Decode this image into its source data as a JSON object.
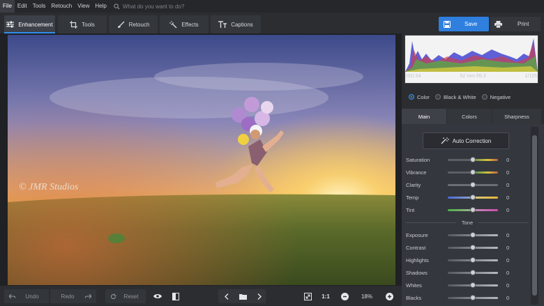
{
  "menu": {
    "items": [
      "File",
      "Edit",
      "Tools",
      "Retouch",
      "View",
      "Help"
    ],
    "search_placeholder": "What do you want to do?"
  },
  "tabs": [
    {
      "label": "Enhancement",
      "icon": "sliders-icon"
    },
    {
      "label": "Tools",
      "icon": "crop-icon"
    },
    {
      "label": "Retouch",
      "icon": "brush-icon"
    },
    {
      "label": "Effects",
      "icon": "magic-wand-icon"
    },
    {
      "label": "Captions",
      "icon": "text-icon"
    }
  ],
  "actions": {
    "save": "Save",
    "print": "Print"
  },
  "photo": {
    "watermark": "© JMR Studios"
  },
  "bottom": {
    "undo": "Undo",
    "redo": "Redo",
    "reset": "Reset",
    "ratio": "1:1",
    "zoom": "18%"
  },
  "histogram": {
    "iso": "ISO 64",
    "lens": "52 mm f/6.3",
    "shutter": "1/125"
  },
  "modes": {
    "selected": "Color",
    "items": [
      "Color",
      "Black & White",
      "Negative"
    ]
  },
  "panel_tabs": [
    "Main",
    "Colors",
    "Sharpness"
  ],
  "auto_correction": "Auto Correction",
  "sliders": [
    {
      "name": "Saturation",
      "value": "0"
    },
    {
      "name": "Vibrance",
      "value": "0"
    },
    {
      "name": "Clarity",
      "value": "0"
    },
    {
      "name": "Temp",
      "value": "0"
    },
    {
      "name": "Tint",
      "value": "0"
    }
  ],
  "tone": {
    "title": "Tone",
    "sliders": [
      {
        "name": "Exposure",
        "value": "0"
      },
      {
        "name": "Contrast",
        "value": "0"
      },
      {
        "name": "Highlights",
        "value": "0"
      },
      {
        "name": "Shadows",
        "value": "0"
      },
      {
        "name": "Whites",
        "value": "0"
      },
      {
        "name": "Blacks",
        "value": "0"
      }
    ]
  },
  "colors": {
    "accent": "#2f8ff0",
    "save": "#2f7fde"
  }
}
